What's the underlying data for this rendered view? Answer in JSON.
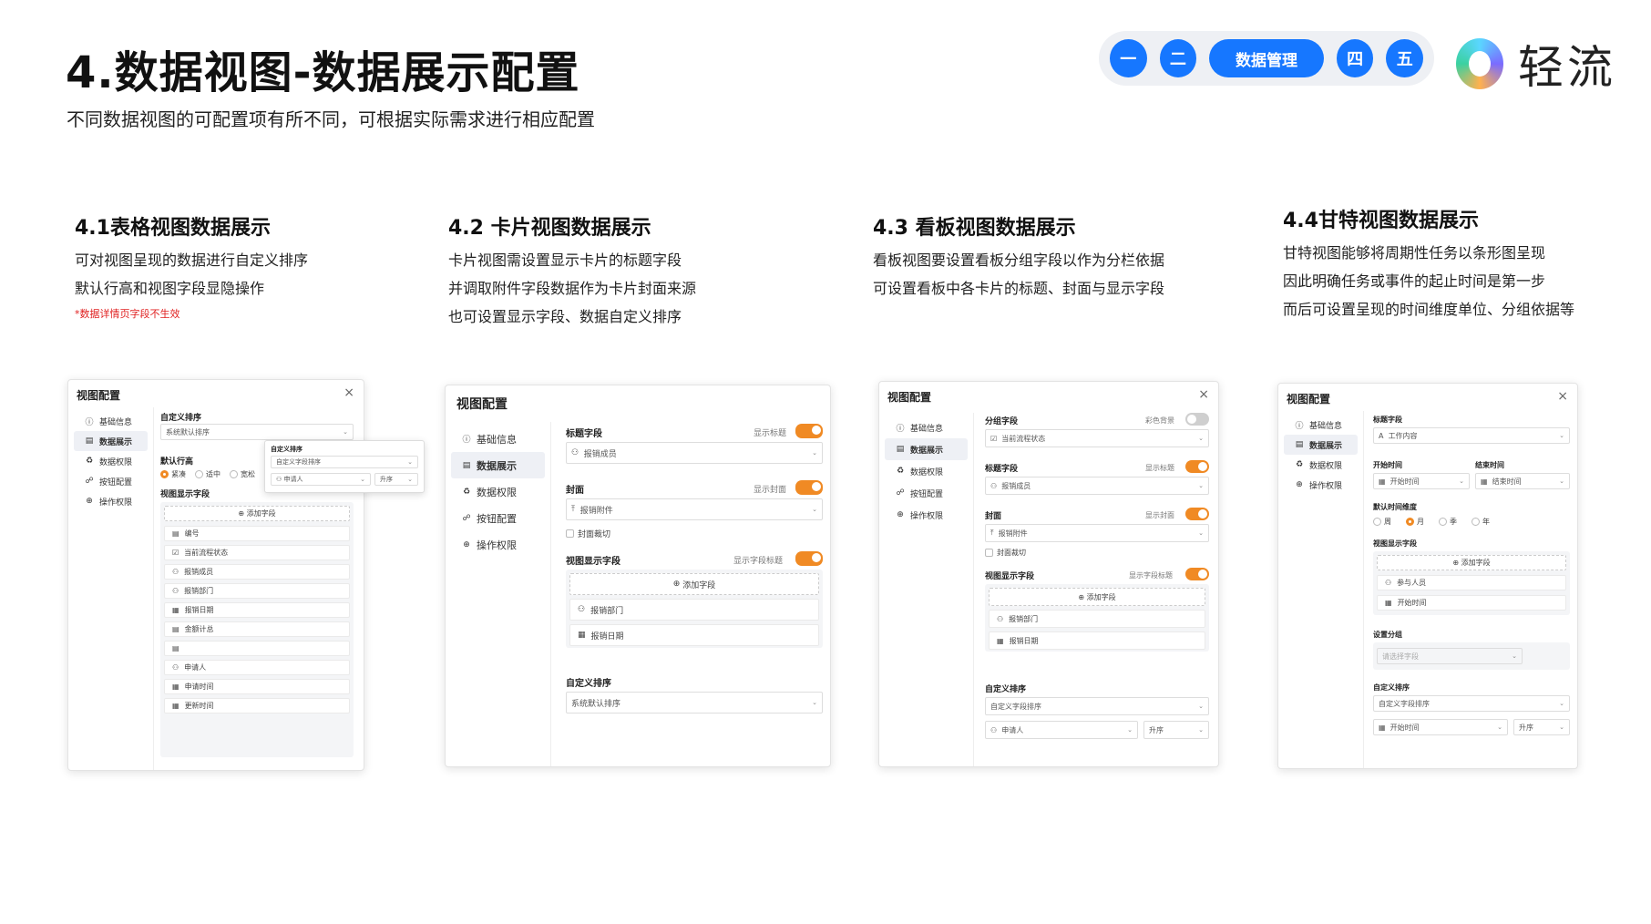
{
  "header": {
    "title": "4.数据视图-数据展示配置",
    "subtitle": "不同数据视图的可配置项有所不同，可根据实际需求进行相应配置"
  },
  "steps": [
    "一",
    "二",
    "数据管理",
    "四",
    "五"
  ],
  "logo": {
    "text": "轻流"
  },
  "sections": [
    {
      "heading": "4.1表格视图数据展示",
      "lines": [
        "可对视图呈现的数据进行自定义排序",
        "默认行高和视图字段显隐操作"
      ],
      "note": "*数据详情页字段不生效"
    },
    {
      "heading": "4.2 卡片视图数据展示",
      "lines": [
        "卡片视图需设置显示卡片的标题字段",
        "并调取附件字段数据作为卡片封面来源",
        "也可设置显示字段、数据自定义排序"
      ]
    },
    {
      "heading": "4.3 看板视图数据展示",
      "lines": [
        "看板视图要设置看板分组字段以作为分栏依据",
        "可设置看板中各卡片的标题、封面与显示字段"
      ]
    },
    {
      "heading": "4.4甘特视图数据展示",
      "lines": [
        "甘特视图能够将周期性任务以条形图呈现",
        "因此明确任务或事件的起止时间是第一步",
        "而后可设置呈现的时间维度单位、分组依据等"
      ]
    }
  ],
  "dialog": {
    "title": "视图配置",
    "close": "×",
    "nav": [
      "基础信息",
      "数据展示",
      "数据权限",
      "按钮配置",
      "操作权限"
    ],
    "nav_icons": [
      "ⓘ",
      "▤",
      "♻",
      "☍",
      "⊕"
    ]
  },
  "table_view": {
    "sort_label": "自定义排序",
    "sort_value": "系统默认排序",
    "row_height_label": "默认行高",
    "row_height_options": [
      "紧凑",
      "适中",
      "宽松"
    ],
    "fields_label": "视图显示字段",
    "add_field": "添加字段",
    "fields": [
      "编号",
      "当前流程状态",
      "报销成员",
      "报销部门",
      "报销日期",
      "金额计总",
      "",
      "申请人",
      "申请时间",
      "更新时间"
    ],
    "popup": {
      "title": "自定义排序",
      "placeholder": "自定义字段排序",
      "field": "申请人",
      "order": "升序"
    }
  },
  "card_view": {
    "title_label": "标题字段",
    "title_toggle": "显示标题",
    "title_value": "报销成员",
    "cover_label": "封面",
    "cover_toggle": "显示封面",
    "cover_value": "报销附件",
    "crop": "封面裁切",
    "fields_label": "视图显示字段",
    "fields_toggle": "显示字段标题",
    "add_field": "添加字段",
    "fields": [
      "报销部门",
      "报销日期"
    ],
    "sort_label": "自定义排序",
    "sort_value": "系统默认排序"
  },
  "kanban_view": {
    "group_label": "分组字段",
    "group_toggle": "彩色背景",
    "group_value": "当前流程状态",
    "title_label": "标题字段",
    "title_toggle": "显示标题",
    "title_value": "报销成员",
    "cover_label": "封面",
    "cover_toggle": "显示封面",
    "cover_value": "报销附件",
    "crop": "封面裁切",
    "fields_label": "视图显示字段",
    "fields_toggle": "显示字段标题",
    "add_field": "添加字段",
    "fields": [
      "报销部门",
      "报销日期"
    ],
    "sort_label": "自定义排序",
    "sort_value": "自定义字段排序",
    "sort_field": "申请人",
    "sort_order": "升序"
  },
  "gantt_view": {
    "title_label": "标题字段",
    "title_value": "工作内容",
    "start_label": "开始时间",
    "start_value": "开始时间",
    "end_label": "结束时间",
    "end_value": "结束时间",
    "unit_label": "默认时间维度",
    "units": [
      "周",
      "月",
      "季",
      "年"
    ],
    "fields_label": "视图显示字段",
    "add_field": "添加字段",
    "fields": [
      "参与人员",
      "开始时间"
    ],
    "group_label": "设置分组",
    "group_placeholder": "请选择字段",
    "sort_label": "自定义排序",
    "sort_value": "自定义字段排序",
    "sort_field": "开始时间",
    "sort_order": "升序"
  }
}
